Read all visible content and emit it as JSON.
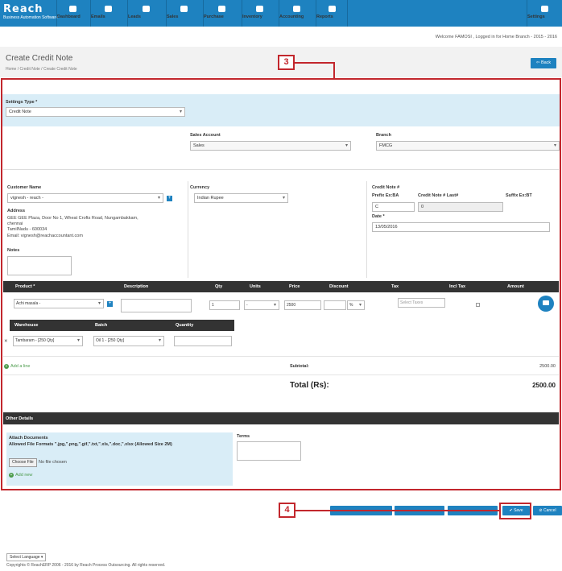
{
  "brand": {
    "name": "Reach",
    "tagline": "Business Automation Software"
  },
  "nav": [
    {
      "label": "Dashboard",
      "icon": "dashboard-icon"
    },
    {
      "label": "Emails",
      "icon": "mail-icon"
    },
    {
      "label": "Leads",
      "icon": "leads-icon"
    },
    {
      "label": "Sales",
      "icon": "cart-icon"
    },
    {
      "label": "Purchase",
      "icon": "purchase-icon"
    },
    {
      "label": "Inventory",
      "icon": "inventory-icon"
    },
    {
      "label": "Accounting",
      "icon": "calculator-icon"
    },
    {
      "label": "Reports",
      "icon": "reports-icon"
    }
  ],
  "settings_label": "Settings",
  "welcome": "Welcome FAMOSI , Logged in for Home Branch - 2015 - 2016",
  "page_title": "Create Credit Note",
  "breadcrumb": "Home  /  Credit Note  /  Create Credit Note",
  "back_label": "Back",
  "callouts": {
    "form": "3",
    "save": "4"
  },
  "form": {
    "settings_type_label": "Settings Type *",
    "settings_type_value": "Credit Note",
    "sales_account_label": "Sales Account",
    "sales_account_value": "Sales",
    "branch_label": "Branch",
    "branch_value": "FMCG",
    "customer_label": "Customer Name",
    "customer_value": "vignesh - reach -",
    "address_label": "Address",
    "address_lines": [
      "GEE GEE Plaza, Door No 1, Wheat Crofts Road, Nungambakkam,",
      "chennai",
      "TamilNadu - 600034",
      "Email: vignesh@reachaccountant.com"
    ],
    "notes_label": "Notes",
    "currency_label": "Currency",
    "currency_value": "Indian Rupee",
    "credit_note_label": "Credit Note #",
    "prefix_label": "Prefix Ex:BA",
    "last_label": "Credit Note # Last#",
    "suffix_label": "Suffix Ex:BT",
    "prefix_value": "C",
    "last_value": "0",
    "date_label": "Date *",
    "date_value": "13/05/2016"
  },
  "items_table": {
    "headers": [
      "Product *",
      "Description",
      "Qty",
      "Units",
      "Price",
      "Discount",
      "Tax",
      "Incl Tax",
      "Amount"
    ],
    "row": {
      "product": "Achi masala -",
      "qty": "1",
      "units": "-",
      "price": "2500",
      "discount_unit": "%",
      "tax_placeholder": "Select Taxes"
    }
  },
  "warehouse_table": {
    "headers": [
      "Warehouse",
      "Batch",
      "Quantity"
    ],
    "row": {
      "warehouse": "Tambaram - [250 Qty]",
      "batch": "Oil 1 - [250 Qty]"
    }
  },
  "add_line": "Add a line",
  "subtotal_label": "Subtotal:",
  "subtotal_value": "2500.00",
  "total_label": "Total (Rs):",
  "total_value": "2500.00",
  "other_details": "Other Details",
  "attach_title": "Attach Documents",
  "attach_formats": "Allowed File Formats \".jpg,\".png,\".gif,\".txt,\".xls,\".doc,\".xlsx (Allowed Size 2M)",
  "choose_file": "Choose File",
  "no_file": "No file chosen",
  "add_new": "Add new",
  "terms_label": "Terms",
  "actions": {
    "save": "Save",
    "cancel": "Cancel"
  },
  "language_select": "Select Language",
  "copyright": "Copyrights © ReachERP 2006 - 2016 by Reach Process Outsourcing. All rights reserved.",
  "colors": {
    "primary": "#1e82c0",
    "annotation": "#c2272d",
    "band": "#d9edf7",
    "dark": "#333333"
  }
}
